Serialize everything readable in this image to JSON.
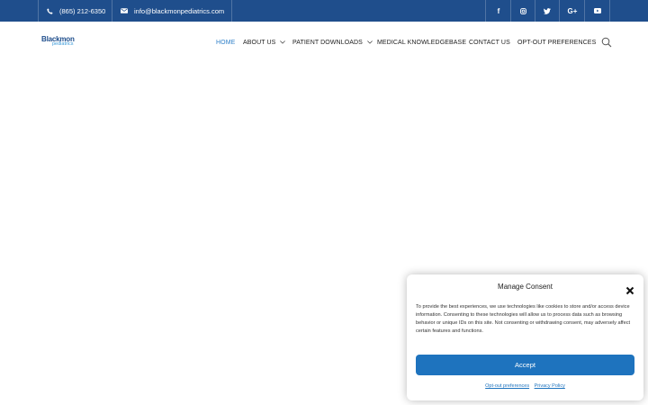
{
  "topbar": {
    "phone": "(865) 212-6350",
    "email": "info@blackmonpediatrics.com",
    "social": [
      "f",
      "◎",
      "t",
      "G+",
      "▶"
    ]
  },
  "header": {
    "logo_line1": "Blackmon",
    "logo_line2": "pediatrics",
    "nav": {
      "home": "HOME",
      "about": "ABOUT US",
      "downloads": "PATIENT DOWNLOADS",
      "knowledge": "MEDICAL KNOWLEDGEBASE",
      "contact": "CONTACT US",
      "optout": "OPT-OUT PREFERENCES"
    }
  },
  "consent": {
    "title": "Manage Consent",
    "body": "To provide the best experiences, we use technologies like cookies to store and/or access device information. Consenting to these technologies will allow us to process data such as browsing behavior or unique IDs on this site. Not consenting or withdrawing consent, may adversely affect certain features and functions.",
    "accept_label": "Accept",
    "optout_link": "Opt-out preferences",
    "privacy_link": "Privacy Policy"
  },
  "colors": {
    "topbar": "#1f4e8c",
    "active_nav": "#2f80c9",
    "accept_button": "#1e73be"
  }
}
